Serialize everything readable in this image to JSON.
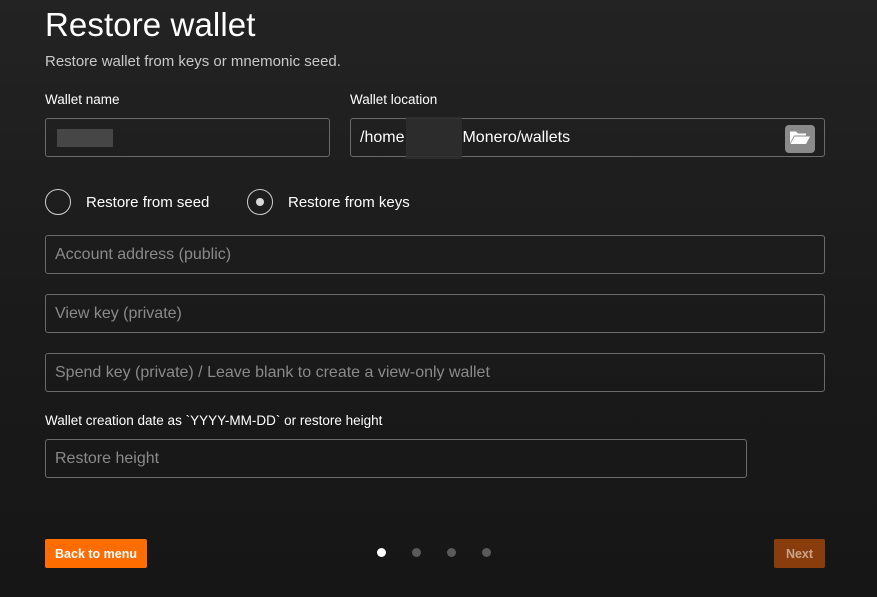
{
  "header": {
    "title": "Restore wallet",
    "subtitle": "Restore wallet from keys or mnemonic seed."
  },
  "wallet_name": {
    "label": "Wallet name",
    "value": ""
  },
  "wallet_location": {
    "label": "Wallet location",
    "value_prefix": "/home",
    "value_suffix": "Monero/wallets",
    "browse_icon": "folder-open-icon"
  },
  "restore_mode": {
    "options": [
      {
        "label": "Restore from seed",
        "selected": false
      },
      {
        "label": "Restore from keys",
        "selected": true
      }
    ]
  },
  "keys": {
    "address_placeholder": "Account address (public)",
    "view_key_placeholder": "View key (private)",
    "spend_key_placeholder": "Spend key (private) / Leave blank to create a view-only wallet"
  },
  "restore_height": {
    "label": "Wallet creation date as `YYYY-MM-DD` or restore height",
    "placeholder": "Restore height"
  },
  "footer": {
    "back_label": "Back to menu",
    "next_label": "Next",
    "page_count": 4,
    "current_page": 1
  },
  "colors": {
    "accent": "#ff6c00",
    "accent_disabled": "#8a3d0c",
    "background": "#1b1b1b"
  }
}
